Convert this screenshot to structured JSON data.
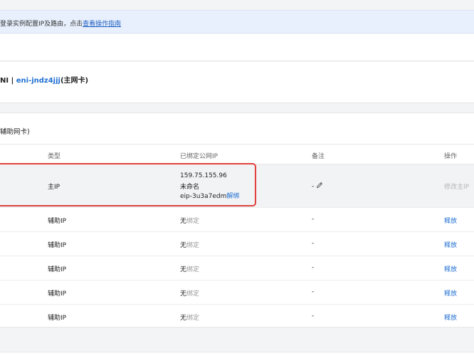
{
  "notice": {
    "text": "登录实例配置IP及路由，点击",
    "link": "查看操作指南"
  },
  "eni": {
    "prefix": "NI | ",
    "id": "eni-jndz4jjj",
    "suffix": "(主网卡)"
  },
  "card": {
    "title": "辅助网卡)"
  },
  "table": {
    "columns": {
      "type": "类型",
      "eip": "已绑定公网IP",
      "remark": "备注",
      "action": "操作"
    },
    "primary_row": {
      "type": "主IP",
      "ip": "159.75.155.96",
      "name": "未命名",
      "eip_id": "eip-3u3a7edm",
      "unbind": "解绑",
      "remark": "-",
      "action": "修改主IP"
    },
    "secondary_rows": [
      {
        "type": "辅助IP",
        "eip_none": "无",
        "eip_unbound": "绑定",
        "remark": "-",
        "action": "释放"
      },
      {
        "type": "辅助IP",
        "eip_none": "无",
        "eip_unbound": "绑定",
        "remark": "-",
        "action": "释放"
      },
      {
        "type": "辅助IP",
        "eip_none": "无",
        "eip_unbound": "绑定",
        "remark": "-",
        "action": "释放"
      },
      {
        "type": "辅助IP",
        "eip_none": "无",
        "eip_unbound": "绑定",
        "remark": "-",
        "action": "释放"
      },
      {
        "type": "辅助IP",
        "eip_none": "无",
        "eip_unbound": "绑定",
        "remark": "-",
        "action": "释放"
      }
    ]
  },
  "colors": {
    "accent": "#1f6fd1",
    "highlight_border": "#e0413a",
    "notice_bg": "#e8f0fd"
  }
}
